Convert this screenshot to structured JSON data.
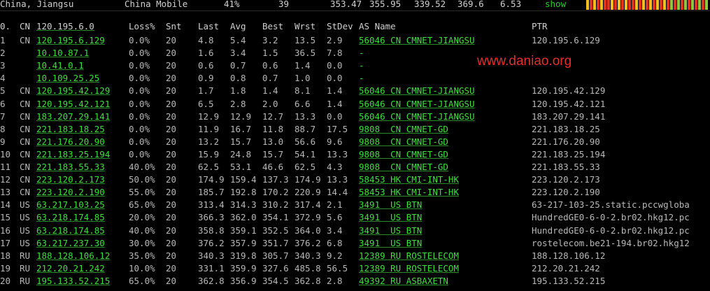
{
  "topbar": {
    "location": "China, Jiangsu",
    "isp": "China Mobile",
    "loss": "41%",
    "snt": "39",
    "v1": "353.47",
    "v2": "355.95",
    "v3": "339.52",
    "v4": "369.6",
    "v5": "6.53",
    "show": "show",
    "spark_colors": [
      "#f0c020",
      "#e03020",
      "#f0c020",
      "#e03020",
      "#f0c020",
      "#e03020",
      "#e03020",
      "#f0c020",
      "#e03020",
      "#f0c020",
      "#e03020",
      "#f0c020",
      "#e03020",
      "#e03020",
      "#f0c020",
      "#e03020",
      "#f0c020",
      "#e03020",
      "#f0c020",
      "#e03020",
      "#f0c020",
      "#e03020",
      "#f0c020",
      "#e03020",
      "#8cc63f",
      "#e03020",
      "#8cc63f",
      "#e03020",
      "#8cc63f",
      "#e03020",
      "#8cc63f",
      "#e03020",
      "#8cc63f",
      "#e03020",
      "#8cc63f"
    ]
  },
  "watermark": "www.daniao.org",
  "header": {
    "no": "0.",
    "cc": "CN",
    "ip": "120.195.6.0",
    "loss": "Loss%",
    "snt": "Snt",
    "last": "Last",
    "avg": "Avg",
    "best": "Best",
    "wrst": "Wrst",
    "std": "StDev",
    "as": "AS Name",
    "ptr": "PTR"
  },
  "hops": [
    {
      "no": "1",
      "cc": "CN",
      "ip": "120.195.6.129",
      "loss": "0.0%",
      "snt": "20",
      "last": "4.8",
      "avg": "5.4",
      "best": "3.2",
      "wrst": "13.5",
      "std": "2.9",
      "as": "56046 CN CMNET-JIANGSU",
      "ptr": "120.195.6.129"
    },
    {
      "no": "2",
      "cc": "",
      "ip": "10.10.87.1",
      "loss": "0.0%",
      "snt": "20",
      "last": "1.6",
      "avg": "3.4",
      "best": "1.5",
      "wrst": "36.5",
      "std": "7.8",
      "as": "-",
      "ptr": ""
    },
    {
      "no": "3",
      "cc": "",
      "ip": "10.41.0.1",
      "loss": "0.0%",
      "snt": "20",
      "last": "0.6",
      "avg": "0.7",
      "best": "0.6",
      "wrst": "1.4",
      "std": "0.0",
      "as": "-",
      "ptr": ""
    },
    {
      "no": "4",
      "cc": "",
      "ip": "10.109.25.25",
      "loss": "0.0%",
      "snt": "20",
      "last": "0.9",
      "avg": "0.8",
      "best": "0.7",
      "wrst": "1.0",
      "std": "0.0",
      "as": "-",
      "ptr": ""
    },
    {
      "no": "5",
      "cc": "CN",
      "ip": "120.195.42.129",
      "loss": "0.0%",
      "snt": "20",
      "last": "1.7",
      "avg": "1.8",
      "best": "1.4",
      "wrst": "8.1",
      "std": "1.4",
      "as": "56046 CN CMNET-JIANGSU",
      "ptr": "120.195.42.129"
    },
    {
      "no": "6",
      "cc": "CN",
      "ip": "120.195.42.121",
      "loss": "0.0%",
      "snt": "20",
      "last": "6.5",
      "avg": "2.8",
      "best": "2.0",
      "wrst": "6.6",
      "std": "1.4",
      "as": "56046 CN CMNET-JIANGSU",
      "ptr": "120.195.42.121"
    },
    {
      "no": "7",
      "cc": "CN",
      "ip": "183.207.29.141",
      "loss": "0.0%",
      "snt": "20",
      "last": "12.9",
      "avg": "12.9",
      "best": "12.7",
      "wrst": "13.3",
      "std": "0.0",
      "as": "56046 CN CMNET-JIANGSU",
      "ptr": "183.207.29.141"
    },
    {
      "no": "8",
      "cc": "CN",
      "ip": "221.183.18.25",
      "loss": "0.0%",
      "snt": "20",
      "last": "11.9",
      "avg": "16.7",
      "best": "11.8",
      "wrst": "88.7",
      "std": "17.5",
      "as": "9808  CN CMNET-GD",
      "ptr": "221.183.18.25"
    },
    {
      "no": "9",
      "cc": "CN",
      "ip": "221.176.20.90",
      "loss": "0.0%",
      "snt": "20",
      "last": "13.2",
      "avg": "15.7",
      "best": "13.0",
      "wrst": "56.6",
      "std": "9.6",
      "as": "9808  CN CMNET-GD",
      "ptr": "221.176.20.90"
    },
    {
      "no": "10",
      "cc": "CN",
      "ip": "221.183.25.194",
      "loss": "0.0%",
      "snt": "20",
      "last": "15.9",
      "avg": "24.8",
      "best": "15.7",
      "wrst": "54.1",
      "std": "13.3",
      "as": "9808  CN CMNET-GD",
      "ptr": "221.183.25.194"
    },
    {
      "no": "11",
      "cc": "CN",
      "ip": "221.183.55.33",
      "loss": "40.0%",
      "snt": "20",
      "last": "62.5",
      "avg": "53.1",
      "best": "46.6",
      "wrst": "62.5",
      "std": "4.3",
      "as": "9808  CN CMNET-GD",
      "ptr": "221.183.55.33"
    },
    {
      "no": "12",
      "cc": "CN",
      "ip": "223.120.2.173",
      "loss": "50.0%",
      "snt": "20",
      "last": "174.9",
      "avg": "159.4",
      "best": "137.3",
      "wrst": "174.9",
      "std": "13.3",
      "as": "58453 HK CMI-INT-HK",
      "ptr": "223.120.2.173"
    },
    {
      "no": "13",
      "cc": "CN",
      "ip": "223.120.2.190",
      "loss": "55.0%",
      "snt": "20",
      "last": "185.7",
      "avg": "192.8",
      "best": "170.2",
      "wrst": "220.9",
      "std": "14.4",
      "as": "58453 HK CMI-INT-HK",
      "ptr": "223.120.2.190"
    },
    {
      "no": "14",
      "cc": "US",
      "ip": "63.217.103.25",
      "loss": "65.0%",
      "snt": "20",
      "last": "313.4",
      "avg": "314.3",
      "best": "310.2",
      "wrst": "317.4",
      "std": "2.1",
      "as": "3491  US BTN",
      "ptr": "63-217-103-25.static.pccwgloba"
    },
    {
      "no": "15",
      "cc": "US",
      "ip": "63.218.174.85",
      "loss": "20.0%",
      "snt": "20",
      "last": "366.3",
      "avg": "362.0",
      "best": "354.1",
      "wrst": "372.9",
      "std": "5.6",
      "as": "3491  US BTN",
      "ptr": "HundredGE0-6-0-2.br02.hkg12.pc"
    },
    {
      "no": "16",
      "cc": "US",
      "ip": "63.218.174.85",
      "loss": "40.0%",
      "snt": "20",
      "last": "358.8",
      "avg": "359.1",
      "best": "352.5",
      "wrst": "364.0",
      "std": "3.4",
      "as": "3491  US BTN",
      "ptr": "HundredGE0-6-0-2.br02.hkg12.pc"
    },
    {
      "no": "17",
      "cc": "US",
      "ip": "63.217.237.30",
      "loss": "30.0%",
      "snt": "20",
      "last": "376.2",
      "avg": "357.9",
      "best": "351.7",
      "wrst": "376.2",
      "std": "6.8",
      "as": "3491  US BTN",
      "ptr": "rostelecom.be21-194.br02.hkg12"
    },
    {
      "no": "18",
      "cc": "RU",
      "ip": "188.128.106.12",
      "loss": "35.0%",
      "snt": "20",
      "last": "340.3",
      "avg": "319.8",
      "best": "305.7",
      "wrst": "340.3",
      "std": "9.2",
      "as": "12389 RU ROSTELECOM",
      "ptr": "188.128.106.12"
    },
    {
      "no": "19",
      "cc": "RU",
      "ip": "212.20.21.242",
      "loss": "10.0%",
      "snt": "20",
      "last": "331.1",
      "avg": "359.9",
      "best": "327.6",
      "wrst": "485.8",
      "std": "56.5",
      "as": "12389 RU ROSTELECOM",
      "ptr": "212.20.21.242"
    },
    {
      "no": "20",
      "cc": "RU",
      "ip": "195.133.52.215",
      "loss": "65.0%",
      "snt": "20",
      "last": "362.8",
      "avg": "356.9",
      "best": "354.5",
      "wrst": "362.8",
      "std": "2.8",
      "as": "49392 RU ASBAXETN",
      "ptr": "195.133.52.215"
    }
  ]
}
